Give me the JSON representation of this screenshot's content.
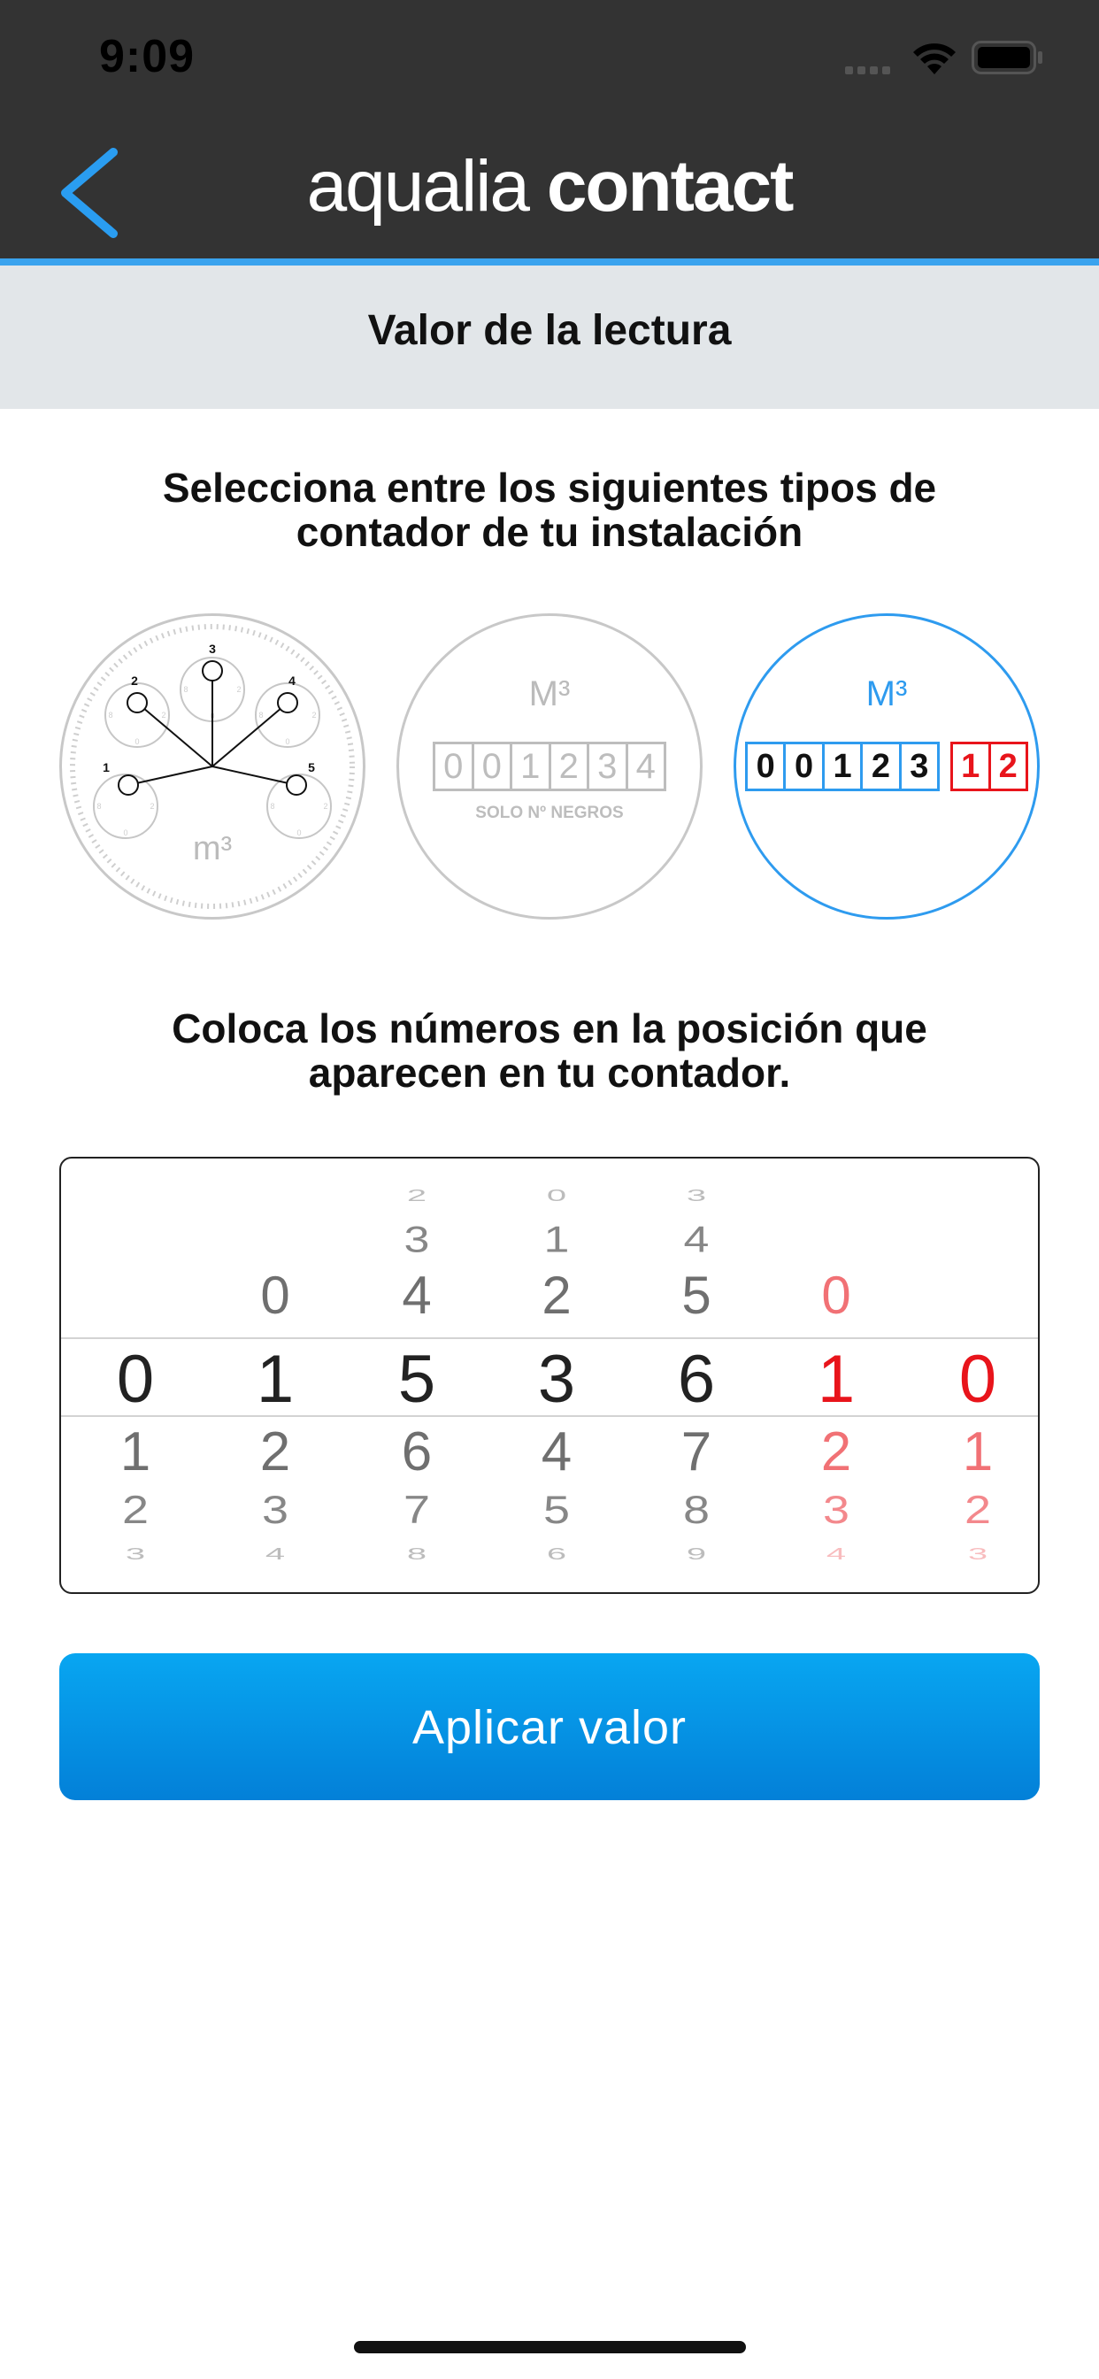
{
  "status_bar": {
    "time": "9:09"
  },
  "nav": {
    "title_part1": "aqualia",
    "title_part2": "contact",
    "back_icon": "chevron-left-icon"
  },
  "header": {
    "title": "Valor de la lectura"
  },
  "instructions": {
    "select_type": "Selecciona entre los siguientes tipos de contador de tu instalación",
    "place_numbers": "Coloca los números en la posición que aparecen en tu contador."
  },
  "meters": [
    {
      "id": "dial",
      "unit": "m³",
      "dial_labels": [
        "1",
        "2",
        "3",
        "4",
        "5"
      ],
      "selected": false
    },
    {
      "id": "black-digits",
      "unit": "M³",
      "digits": [
        "0",
        "0",
        "1",
        "2",
        "3",
        "4"
      ],
      "caption": "SOLO Nº NEGROS",
      "selected": false
    },
    {
      "id": "black-red-digits",
      "unit": "M³",
      "black_digits": [
        "0",
        "0",
        "1",
        "2",
        "3"
      ],
      "red_digits": [
        "1",
        "2"
      ],
      "selected": true
    }
  ],
  "picker": {
    "columns": [
      {
        "above": [
          "",
          "",
          ""
        ],
        "selected": "0",
        "below": [
          "1",
          "2",
          "3"
        ],
        "red": false
      },
      {
        "above": [
          "",
          "",
          "0"
        ],
        "selected": "1",
        "below": [
          "2",
          "3",
          "4"
        ],
        "red": false
      },
      {
        "above": [
          "2",
          "3",
          "4"
        ],
        "selected": "5",
        "below": [
          "6",
          "7",
          "8"
        ],
        "red": false
      },
      {
        "above": [
          "0",
          "1",
          "2"
        ],
        "selected": "3",
        "below": [
          "4",
          "5",
          "6"
        ],
        "red": false
      },
      {
        "above": [
          "3",
          "4",
          "5"
        ],
        "selected": "6",
        "below": [
          "7",
          "8",
          "9"
        ],
        "red": false
      },
      {
        "above": [
          "",
          "",
          "0"
        ],
        "selected": "1",
        "below": [
          "2",
          "3",
          "4"
        ],
        "red": true
      },
      {
        "above": [
          "",
          "",
          ""
        ],
        "selected": "0",
        "below": [
          "1",
          "2",
          "3"
        ],
        "red": true
      }
    ]
  },
  "apply_button": {
    "label": "Aplicar valor"
  },
  "colors": {
    "accent": "#3aa3ee",
    "button": "#0795e6",
    "red": "#e8141b",
    "bar": "#333333"
  }
}
